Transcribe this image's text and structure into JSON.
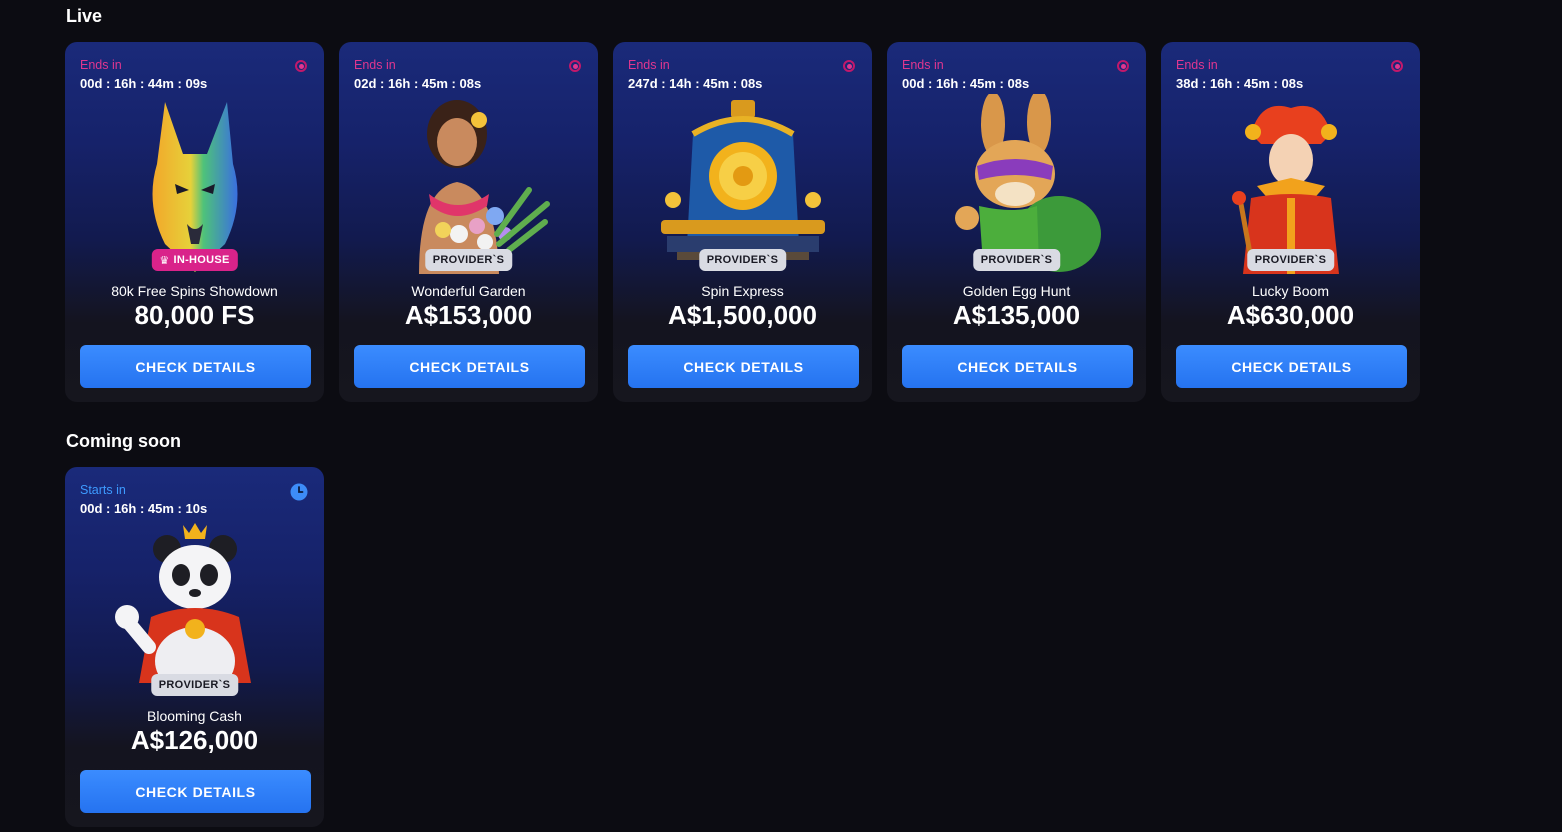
{
  "sections": {
    "live_title": "Live",
    "soon_title": "Coming soon"
  },
  "live_cards": [
    {
      "timer_label": "Ends in",
      "timer": "00d : 16h : 44m : 09s",
      "badge": "IN-HOUSE",
      "name": "80k Free Spins Showdown",
      "prize": "80,000 FS",
      "button": "CHECK DETAILS",
      "art_icon": "wolf-icon"
    },
    {
      "timer_label": "Ends in",
      "timer": "02d : 16h : 45m : 08s",
      "badge": "PROVIDER`S",
      "name": "Wonderful Garden",
      "prize": "A$153,000",
      "button": "CHECK DETAILS",
      "art_icon": "flower-girl-icon"
    },
    {
      "timer_label": "Ends in",
      "timer": "247d : 14h : 45m : 08s",
      "badge": "PROVIDER`S",
      "name": "Spin Express",
      "prize": "A$1,500,000",
      "button": "CHECK DETAILS",
      "art_icon": "train-icon"
    },
    {
      "timer_label": "Ends in",
      "timer": "00d : 16h : 45m : 08s",
      "badge": "PROVIDER`S",
      "name": "Golden Egg Hunt",
      "prize": "A$135,000",
      "button": "CHECK DETAILS",
      "art_icon": "rabbit-icon"
    },
    {
      "timer_label": "Ends in",
      "timer": "38d : 16h : 45m : 08s",
      "badge": "PROVIDER`S",
      "name": "Lucky Boom",
      "prize": "A$630,000",
      "button": "CHECK DETAILS",
      "art_icon": "jester-icon"
    }
  ],
  "soon_cards": [
    {
      "timer_label": "Starts in",
      "timer": "00d : 16h : 45m : 10s",
      "badge": "PROVIDER`S",
      "name": "Blooming Cash",
      "prize": "A$126,000",
      "button": "CHECK DETAILS",
      "art_icon": "panda-icon"
    }
  ],
  "colors": {
    "background": "#0c0c12",
    "accent_button": "#2f80f7",
    "ends_in": "#e0368f",
    "starts_in": "#3d9bff",
    "inhouse_badge": "#d9238a",
    "provider_badge": "#d9dbe3"
  }
}
